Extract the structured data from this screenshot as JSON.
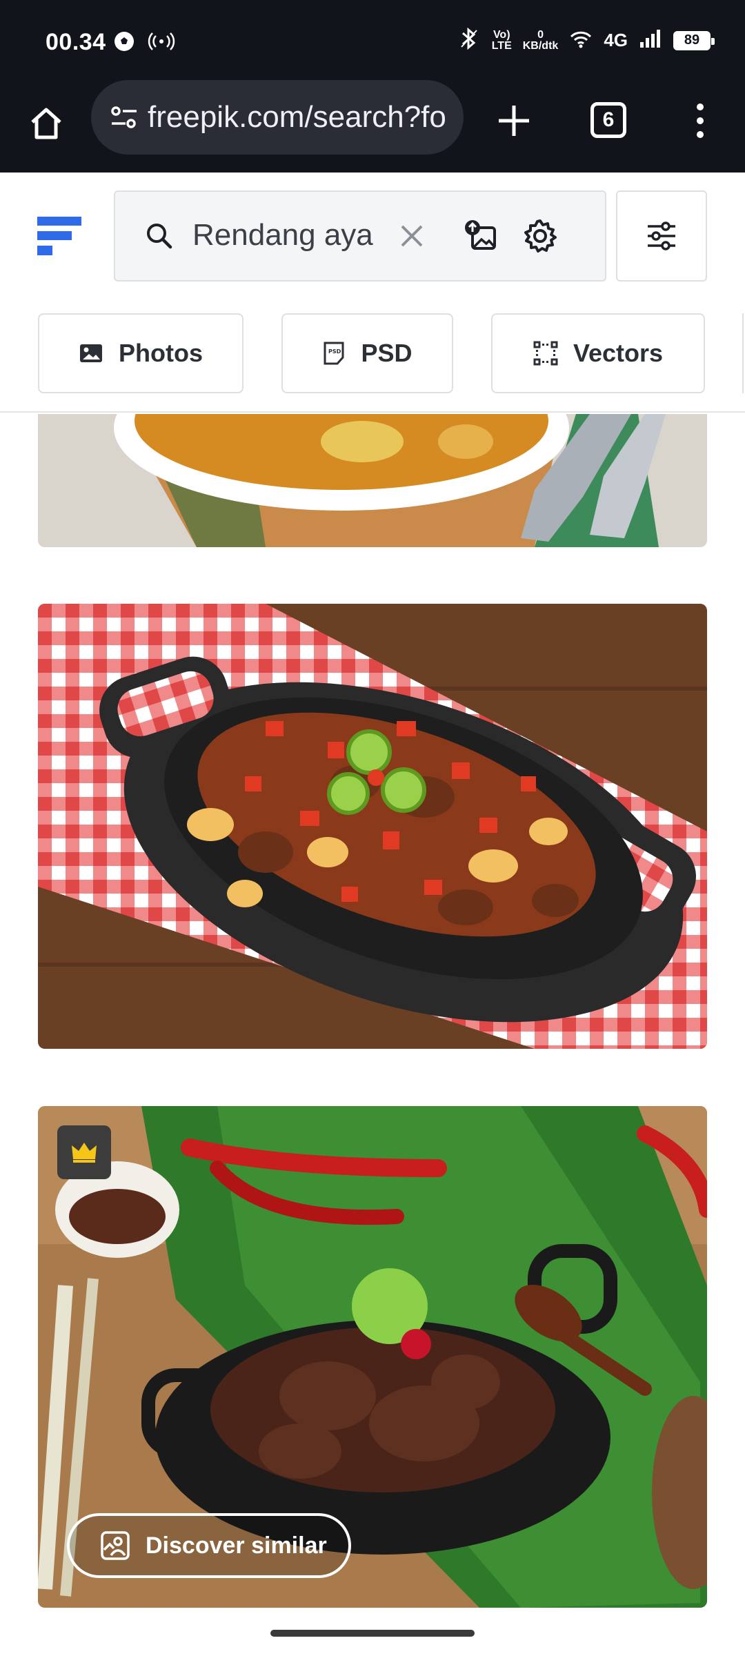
{
  "status_bar": {
    "time": "00.34",
    "volte_top": "Vo)",
    "volte_bottom": "LTE",
    "net_speed_top": "0",
    "net_speed_bottom": "KB/dtk",
    "network": "4G",
    "battery": "89"
  },
  "browser": {
    "url": "freepik.com/search?fo",
    "tab_count": "6"
  },
  "search": {
    "query": "Rendang aya"
  },
  "filters": [
    {
      "label": "Photos",
      "icon": "image-icon"
    },
    {
      "label": "PSD",
      "icon": "psd-file-icon"
    },
    {
      "label": "Vectors",
      "icon": "vector-icon"
    }
  ],
  "results": {
    "discover_label": "Discover similar"
  },
  "colors": {
    "brand_blue": "#2f6be8",
    "status_bg": "#12141c",
    "premium_gold": "#f5c518"
  }
}
